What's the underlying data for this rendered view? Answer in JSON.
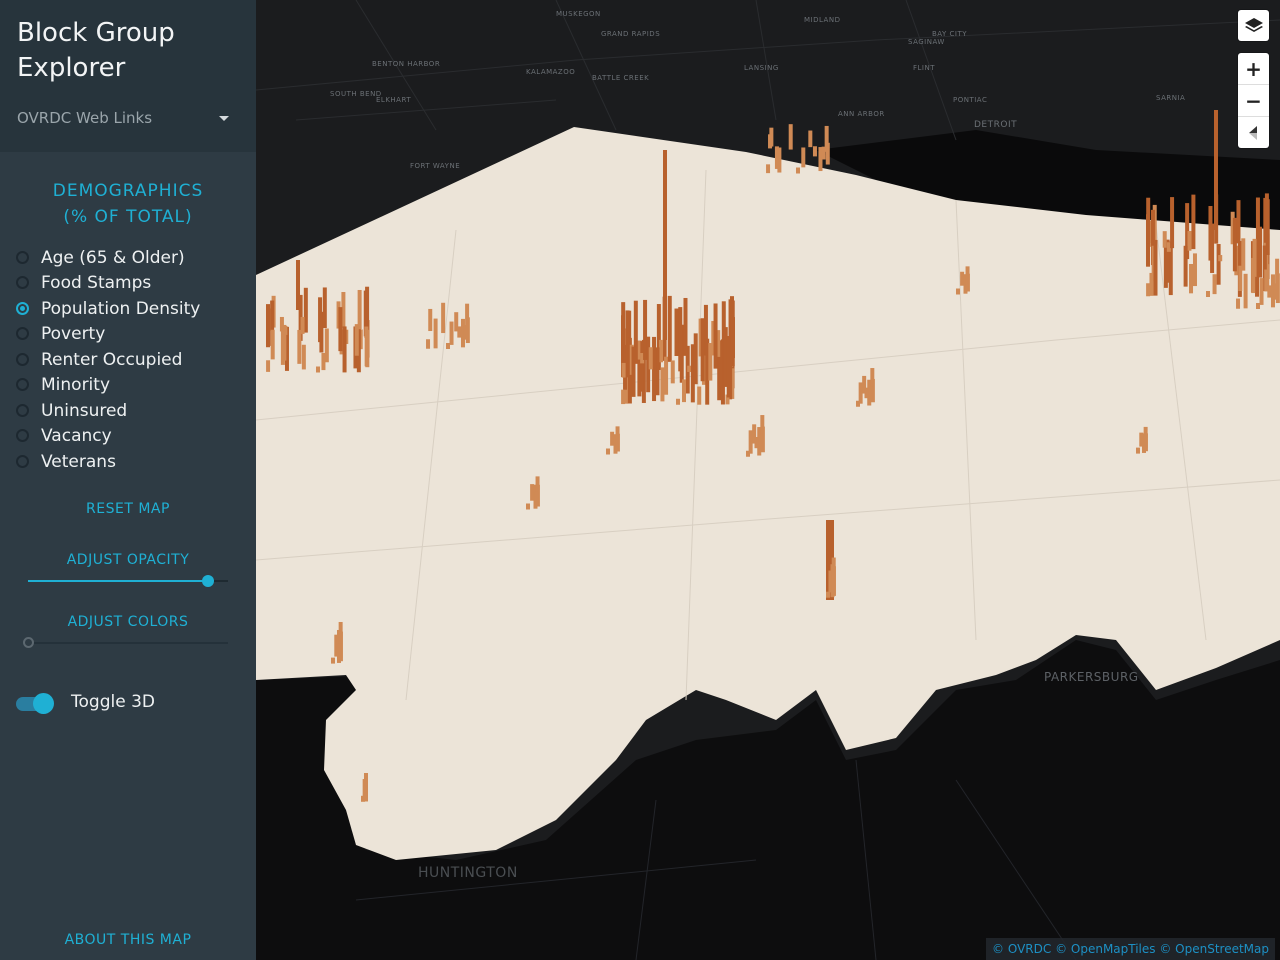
{
  "sidebar": {
    "title_line1": "Block Group",
    "title_line2": "Explorer",
    "links_dropdown": "OVRDC Web Links",
    "demographics_line1": "DEMOGRAPHICS",
    "demographics_line2": "(% OF TOTAL)",
    "options": [
      {
        "label": "Age (65 & Older)",
        "checked": false
      },
      {
        "label": "Food Stamps",
        "checked": false
      },
      {
        "label": "Population Density",
        "checked": true
      },
      {
        "label": "Poverty",
        "checked": false
      },
      {
        "label": "Renter Occupied",
        "checked": false
      },
      {
        "label": "Minority",
        "checked": false
      },
      {
        "label": "Uninsured",
        "checked": false
      },
      {
        "label": "Vacancy",
        "checked": false
      },
      {
        "label": "Veterans",
        "checked": false
      }
    ],
    "reset_map": "RESET MAP",
    "adjust_opacity": "ADJUST OPACITY",
    "opacity_value": 0.9,
    "adjust_colors": "ADJUST COLORS",
    "colors_value": 0,
    "toggle_3d_label": "Toggle 3D",
    "toggle_3d_on": true,
    "about": "ABOUT THIS MAP"
  },
  "map": {
    "labels": {
      "detroit": "DETROIT",
      "parkersburg": "PARKERSBURG",
      "huntington": "HUNTINGTON",
      "fort_wayne": "FORT WAYNE",
      "ann_arbor": "ANN ARBOR",
      "lansing": "LANSING",
      "flint": "FLINT",
      "pontiac": "PONTIAC",
      "saginaw": "SAGINAW",
      "bay_city": "BAY CITY",
      "kalamazoo": "KALAMAZOO",
      "battle_creek": "BATTLE CREEK",
      "grand_rapids": "GRAND RAPIDS",
      "benton_harbor": "BENTON HARBOR",
      "south_bend": "SOUTH BEND",
      "elkhart": "ELKHART",
      "midland": "MIDLAND",
      "muskegon": "MUSKEGON",
      "sarnia": "SARNIA"
    },
    "controls": {
      "layers": "layers-icon",
      "zoom_in": "+",
      "zoom_out": "−",
      "compass": "compass-icon"
    },
    "attribution": "© OVRDC © OpenMapTiles © OpenStreetMap",
    "colors": {
      "land": "#ece4d8",
      "bars": "#c8703a",
      "water": "#0c0c0d",
      "accent": "#1fb0d4"
    }
  }
}
